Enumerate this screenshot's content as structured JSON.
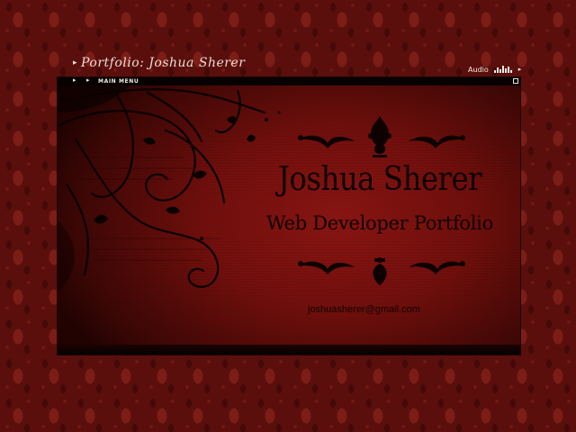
{
  "header": {
    "title": "Portfolio: Joshua Sherer",
    "audio_label": "Audio"
  },
  "menu": {
    "label": "MAIN MENU"
  },
  "hero": {
    "name": "Joshua Sherer",
    "subtitle": "Web Developer Portfolio",
    "email": "joshuasherer@gmail.com"
  },
  "colors": {
    "background": "#5a0f0c",
    "panel": "#7a120f",
    "ink": "#0e0201",
    "light_text": "#e8ddd6"
  }
}
